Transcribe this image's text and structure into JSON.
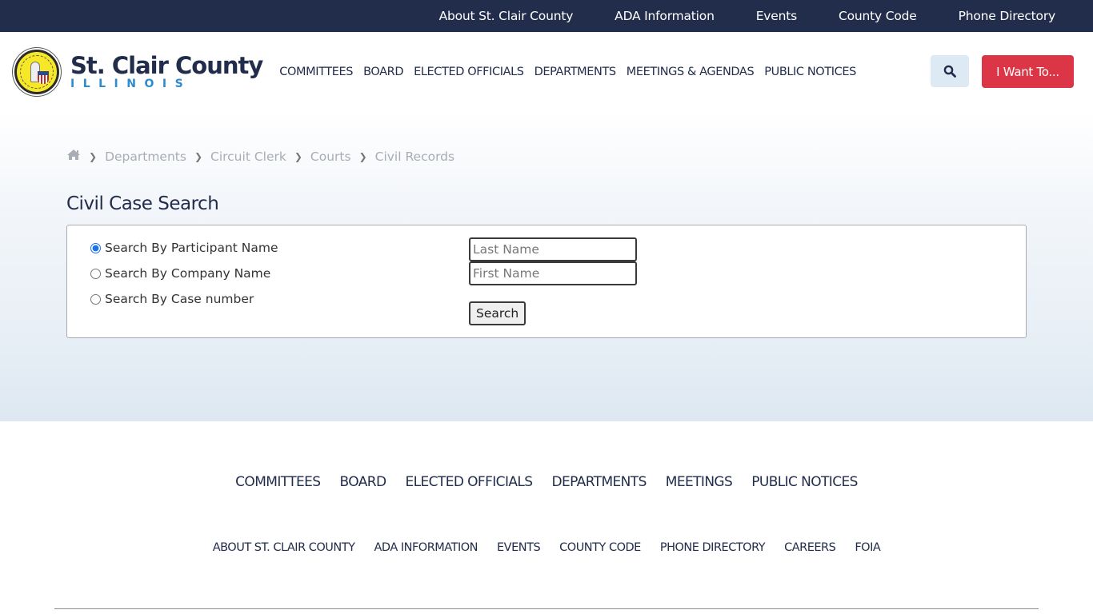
{
  "topbar": {
    "links": [
      "About St. Clair County",
      "ADA Information",
      "Events",
      "County Code",
      "Phone Directory"
    ]
  },
  "header": {
    "logo_title": "St. Clair County",
    "logo_subtitle": "ILLINOIS",
    "logo_icon": "county-seal-icon",
    "nav": [
      "COMMITTEES",
      "BOARD",
      "ELECTED OFFICIALS",
      "DEPARTMENTS",
      "MEETINGS & AGENDAS",
      "PUBLIC NOTICES"
    ],
    "search_icon": "search-icon",
    "cta_label": "I Want To...",
    "cta_color": "#dc3545",
    "brand_color": "#222d4b"
  },
  "breadcrumb": {
    "home_icon": "home-icon",
    "items": [
      "Departments",
      "Circuit Clerk",
      "Courts",
      "Civil Records"
    ]
  },
  "page": {
    "title": "Civil Case Search"
  },
  "search_form": {
    "options": [
      {
        "label": "Search By Participant Name",
        "selected": true
      },
      {
        "label": "Search By Company Name",
        "selected": false
      },
      {
        "label": "Search By Case number",
        "selected": false
      }
    ],
    "last_name": {
      "value": "",
      "placeholder": "Last Name"
    },
    "first_name": {
      "value": "",
      "placeholder": "First Name"
    },
    "submit_label": "Search"
  },
  "footer": {
    "primary_links": [
      "COMMITTEES",
      "BOARD",
      "ELECTED OFFICIALS",
      "DEPARTMENTS",
      "MEETINGS",
      "PUBLIC NOTICES"
    ],
    "secondary_links": [
      "ABOUT ST. CLAIR COUNTY",
      "ADA INFORMATION",
      "EVENTS",
      "COUNTY CODE",
      "PHONE DIRECTORY",
      "CAREERS",
      "FOIA"
    ]
  }
}
